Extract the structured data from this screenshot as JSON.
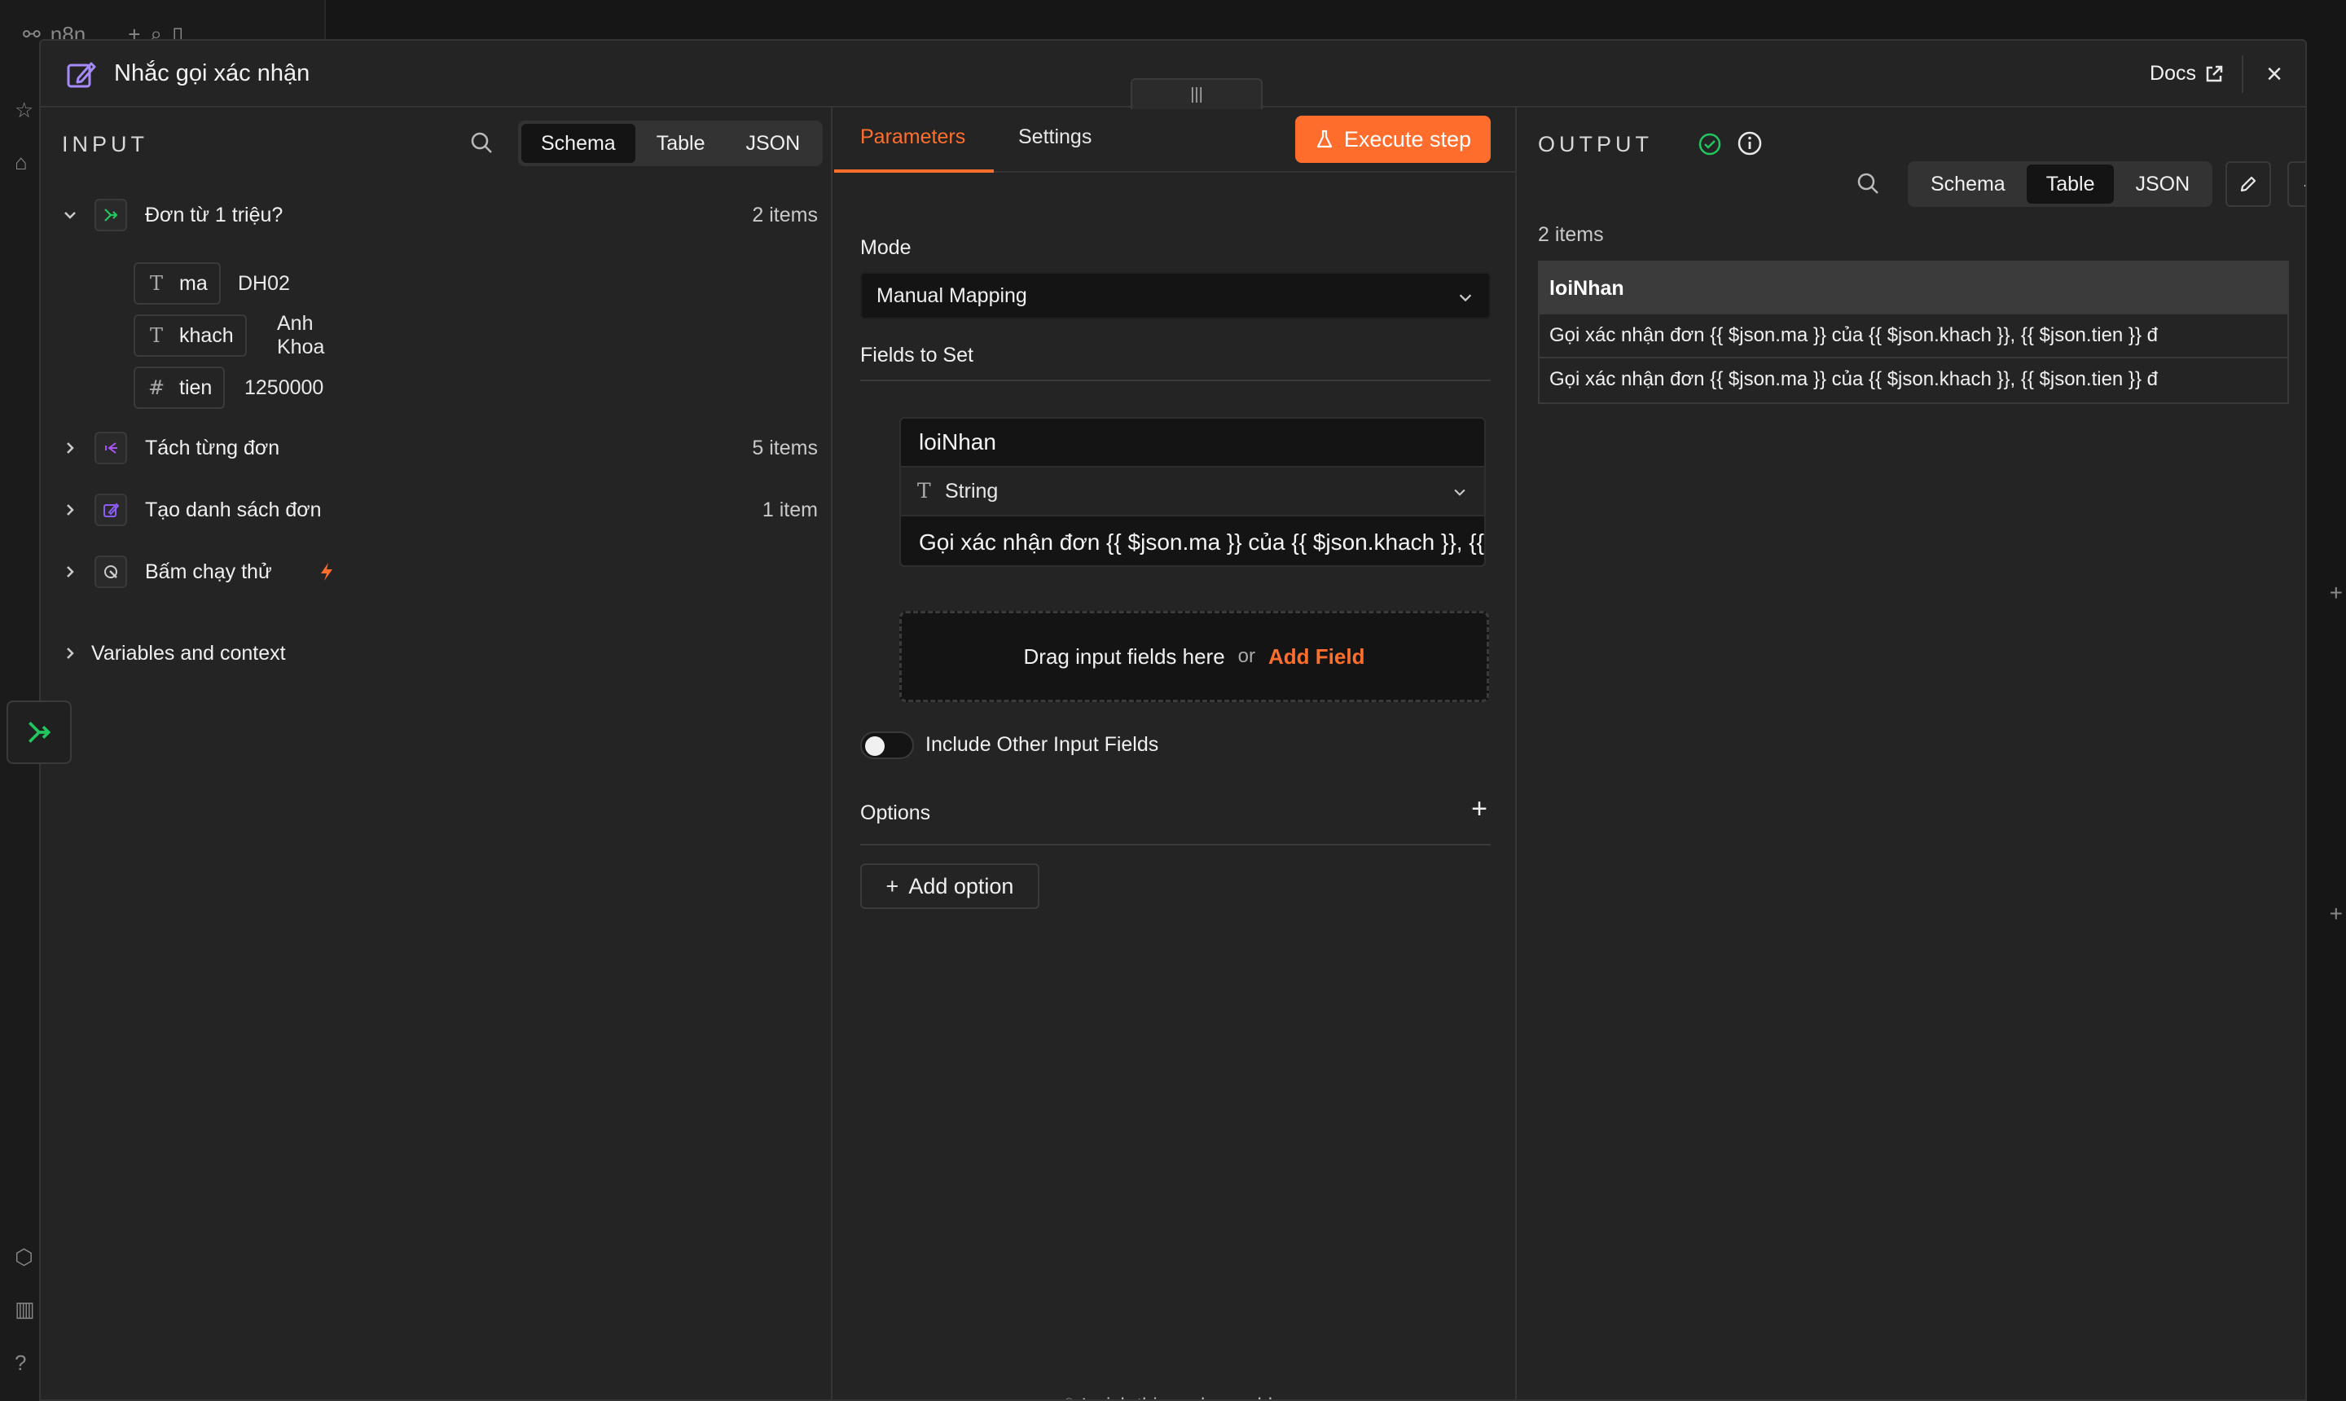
{
  "background": {
    "app_name": "n8n"
  },
  "header": {
    "title": "Nhắc gọi xác nhận",
    "docs_label": "Docs"
  },
  "input": {
    "title": "INPUT",
    "view_tabs": [
      "Schema",
      "Table",
      "JSON"
    ],
    "active_view": "Schema",
    "nodes": [
      {
        "name": "Đơn từ 1 triệu?",
        "count": "2 items",
        "expanded": true,
        "icon": "branch-icon",
        "icon_color": "#22c55e"
      },
      {
        "name": "Tách từng đơn",
        "count": "5 items",
        "expanded": false,
        "icon": "split-icon",
        "icon_color": "#a855f7"
      },
      {
        "name": "Tạo danh sách đơn",
        "count": "1 item",
        "expanded": false,
        "icon": "edit-icon",
        "icon_color": "#8b5cf6"
      },
      {
        "name": "Bấm chạy thử",
        "count": "",
        "expanded": false,
        "icon": "pointer-icon",
        "icon_color": "#cccccc"
      }
    ],
    "fields": [
      {
        "type": "T",
        "key": "ma",
        "value": "DH02"
      },
      {
        "type": "T",
        "key": "khach",
        "value": "Anh Khoa"
      },
      {
        "type": "#",
        "key": "tien",
        "value": "1250000"
      }
    ],
    "variables_label": "Variables and context"
  },
  "params": {
    "tabs": [
      "Parameters",
      "Settings"
    ],
    "active_tab": "Parameters",
    "execute_label": "Execute step",
    "mode_label": "Mode",
    "mode_value": "Manual Mapping",
    "fields_label": "Fields to Set",
    "assignment": {
      "name": "loiNhan",
      "type": "String",
      "value": "Gọi xác nhận đơn {{ $json.ma }} của {{ $json.khach }}, {{ $json.tien }} đ"
    },
    "drop_text": "Drag input fields here",
    "drop_or": "or",
    "add_field": "Add Field",
    "include_label": "Include Other Input Fields",
    "options_label": "Options",
    "add_option": "Add option",
    "wish_text": "I wish this node would..."
  },
  "output": {
    "title": "OUTPUT",
    "view_tabs": [
      "Schema",
      "Table",
      "JSON"
    ],
    "active_view": "Table",
    "count": "2 items",
    "column": "loiNhan",
    "rows": [
      "Gọi xác nhận đơn {{ $json.ma }} của {{ $json.khach }}, {{ $json.tien }} đ",
      "Gọi xác nhận đơn {{ $json.ma }} của {{ $json.khach }}, {{ $json.tien }} đ"
    ]
  },
  "colors": {
    "accent": "#ff6d2d",
    "success": "#22c55e"
  }
}
